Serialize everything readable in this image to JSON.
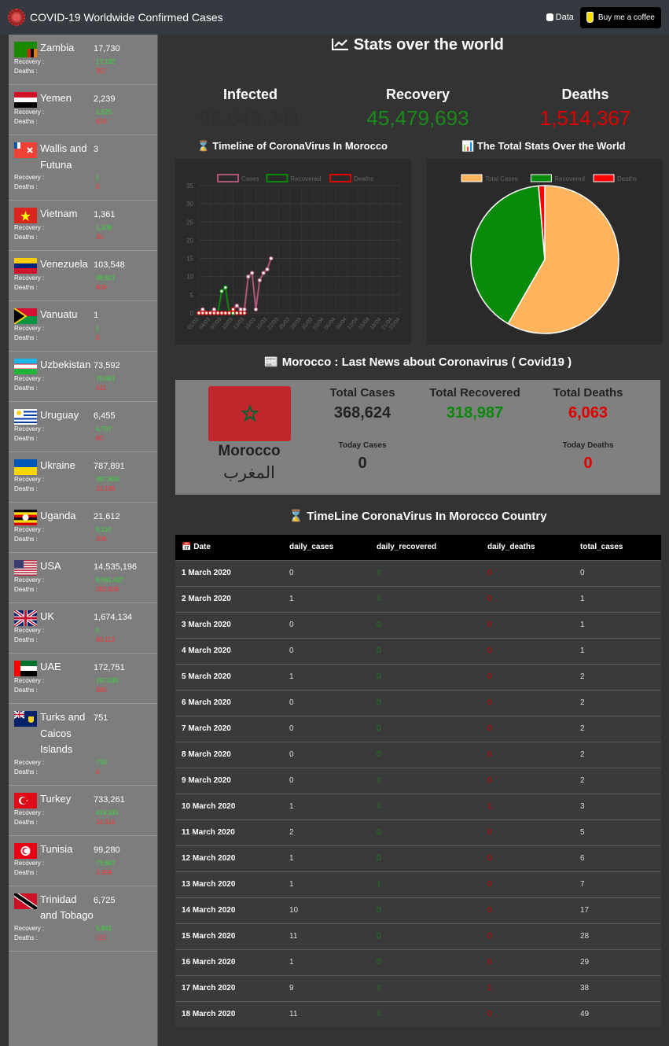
{
  "header": {
    "title": "COVID-19 Worldwide Confirmed Cases",
    "data_label": "Data",
    "coffee_label": "Buy me a coffee"
  },
  "sidebar": {
    "recovery_label": "Recovery :",
    "deaths_label": "Deaths :",
    "countries": [
      {
        "name": "Zambia",
        "cases": "17,730",
        "recovery": "17,102",
        "deaths": "357"
      },
      {
        "name": "Yemen",
        "cases": "2,239",
        "recovery": "1,525",
        "deaths": "624"
      },
      {
        "name": "Wallis and Futuna",
        "cases": "3",
        "recovery": "1",
        "deaths": "0"
      },
      {
        "name": "Vietnam",
        "cases": "1,361",
        "recovery": "1,209",
        "deaths": "35"
      },
      {
        "name": "Venezuela",
        "cases": "103,548",
        "recovery": "98,521",
        "deaths": "909"
      },
      {
        "name": "Vanuatu",
        "cases": "1",
        "recovery": "1",
        "deaths": "0"
      },
      {
        "name": "Uzbekistan",
        "cases": "73,592",
        "recovery": "70,861",
        "deaths": "611"
      },
      {
        "name": "Uruguay",
        "cases": "6,455",
        "recovery": "4,707",
        "deaths": "80"
      },
      {
        "name": "Ukraine",
        "cases": "787,891",
        "recovery": "397,809",
        "deaths": "13,195"
      },
      {
        "name": "Uganda",
        "cases": "21,612",
        "recovery": "9,110",
        "deaths": "206"
      },
      {
        "name": "USA",
        "cases": "14,535,196",
        "recovery": "8,561,427",
        "deaths": "282,829"
      },
      {
        "name": "UK",
        "cases": "1,674,134",
        "recovery": "0",
        "deaths": "60,113"
      },
      {
        "name": "UAE",
        "cases": "172,751",
        "recovery": "157,035",
        "deaths": "585"
      },
      {
        "name": "Turks and Caicos Islands",
        "cases": "751",
        "recovery": "733",
        "deaths": "6"
      },
      {
        "name": "Turkey",
        "cases": "733,261",
        "recovery": "418,331",
        "deaths": "14,316"
      },
      {
        "name": "Tunisia",
        "cases": "99,280",
        "recovery": "73,607",
        "deaths": "3,359"
      },
      {
        "name": "Trinidad and Tobago",
        "cases": "6,725",
        "recovery": "5,861",
        "deaths": "121"
      }
    ]
  },
  "stats": {
    "title": "Stats over the world",
    "infected_label": "Infected",
    "infected": "65,648,341",
    "recovery_label": "Recovery",
    "recovery": "45,479,693",
    "deaths_label": "Deaths",
    "deaths": "1,514,367",
    "colors": {
      "infected": "#2f2f2f",
      "recovery": "#1a8a1a",
      "deaths": "#e00000"
    }
  },
  "charts": {
    "timeline_title": "Timeline of CoronaVirus In Morocco",
    "total_title": "The Total Stats Over the World"
  },
  "chart_data": [
    {
      "type": "line",
      "legend": [
        "Cases",
        "Recovered",
        "Deaths"
      ],
      "legend_position": "top",
      "x": [
        "01/03",
        "02/03",
        "03/03",
        "04/03",
        "05/03",
        "06/03",
        "07/03",
        "08/03",
        "09/03",
        "10/03",
        "11/03",
        "12/03",
        "13/03",
        "14/03",
        "15/03",
        "16/03",
        "17/03",
        "18/03",
        "19/03",
        "20/03",
        "21/03",
        "22/03",
        "23/03",
        "24/03",
        "25/03",
        "26/03",
        "27/03",
        "28/03",
        "29/03",
        "30/03",
        "31/03",
        "01/04",
        "02/04",
        "03/04",
        "04/04",
        "05/04",
        "06/04",
        "07/04",
        "08/04",
        "09/04",
        "10/04",
        "11/04",
        "12/04",
        "13/04",
        "14/04",
        "15/04",
        "16/04",
        "17/04",
        "18/04",
        "19/04",
        "20/04",
        "21/04",
        "22/04",
        "23/04"
      ],
      "x_tick_labels": [
        "01/03",
        "04/03",
        "07/03",
        "10/03",
        "13/03",
        "16/03",
        "19/03",
        "22/03",
        "25/03",
        "28/03",
        "31/03",
        "03/04",
        "06/04",
        "09/04",
        "12/04",
        "15/04",
        "18/04",
        "21/04",
        "23/04"
      ],
      "ylim": [
        0,
        35
      ],
      "y_ticks": [
        0,
        5,
        10,
        15,
        20,
        25,
        30,
        35
      ],
      "series": [
        {
          "name": "Cases",
          "color": "#b0557a",
          "values": [
            0,
            1,
            0,
            0,
            1,
            0,
            0,
            0,
            0,
            1,
            2,
            1,
            1,
            10,
            11,
            1,
            9,
            11,
            12,
            15
          ]
        },
        {
          "name": "Recovered",
          "color": "#0a8a0a",
          "values": [
            0,
            0,
            0,
            0,
            0,
            0,
            6,
            7,
            0,
            0,
            0,
            0
          ]
        },
        {
          "name": "Deaths",
          "color": "#e00000",
          "values": [
            0,
            0,
            0,
            0,
            0,
            0,
            0,
            0,
            0,
            1,
            0,
            0,
            0
          ]
        }
      ]
    },
    {
      "type": "pie",
      "legend": [
        "Total Cases",
        "Recovered",
        "Deaths"
      ],
      "legend_position": "top",
      "values": [
        65648341,
        45479693,
        1514367
      ],
      "colors": [
        "#ffb35c",
        "#0a8a0a",
        "#ff0000"
      ]
    }
  ],
  "morocco": {
    "news_title": "Morocco : Last News about Coronavirus ( Covid19 )",
    "name": "Morocco",
    "name_ar": "المغرب",
    "total_cases_label": "Total Cases",
    "total_cases": "368,624",
    "total_recovered_label": "Total Recovered",
    "total_recovered": "318,987",
    "total_deaths_label": "Total Deaths",
    "total_deaths": "6,063",
    "today_cases_label": "Today Cases",
    "today_cases": "0",
    "today_deaths_label": "Today Deaths",
    "today_deaths": "0"
  },
  "timeline": {
    "title": "TimeLine CoronaVirus In Morocco Country",
    "headers": [
      "Date",
      "daily_cases",
      "daily_recovered",
      "daily_deaths",
      "total_cases"
    ],
    "rows": [
      [
        "1 March 2020",
        "0",
        "0",
        "0",
        "0"
      ],
      [
        "2 March 2020",
        "1",
        "0",
        "0",
        "1"
      ],
      [
        "3 March 2020",
        "0",
        "0",
        "0",
        "1"
      ],
      [
        "4 March 2020",
        "0",
        "0",
        "0",
        "1"
      ],
      [
        "5 March 2020",
        "1",
        "0",
        "0",
        "2"
      ],
      [
        "6 March 2020",
        "0",
        "0",
        "0",
        "2"
      ],
      [
        "7 March 2020",
        "0",
        "0",
        "0",
        "2"
      ],
      [
        "8 March 2020",
        "0",
        "0",
        "0",
        "2"
      ],
      [
        "9 March 2020",
        "0",
        "0",
        "0",
        "2"
      ],
      [
        "10 March 2020",
        "1",
        "0",
        "1",
        "3"
      ],
      [
        "11 March 2020",
        "2",
        "0",
        "0",
        "5"
      ],
      [
        "12 March 2020",
        "1",
        "0",
        "0",
        "6"
      ],
      [
        "13 March 2020",
        "1",
        "1",
        "0",
        "7"
      ],
      [
        "14 March 2020",
        "10",
        "0",
        "0",
        "17"
      ],
      [
        "15 March 2020",
        "11",
        "0",
        "0",
        "28"
      ],
      [
        "16 March 2020",
        "1",
        "0",
        "0",
        "29"
      ],
      [
        "17 March 2020",
        "9",
        "0",
        "1",
        "38"
      ],
      [
        "18 March 2020",
        "11",
        "0",
        "0",
        "49"
      ]
    ]
  }
}
